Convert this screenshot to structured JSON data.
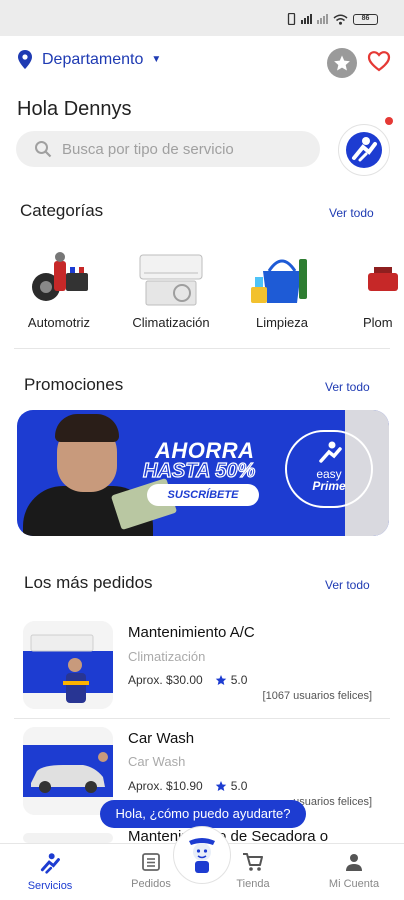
{
  "colors": {
    "brand": "#1d3cd1",
    "accent_red": "#e53935"
  },
  "status_bar": {
    "battery": "86"
  },
  "header": {
    "location": "Departamento",
    "greeting": "Hola Dennys",
    "search_placeholder": "Busca por tipo de servicio"
  },
  "categories": {
    "title": "Categorías",
    "see_all": "Ver todo",
    "items": [
      {
        "label": "Automotriz"
      },
      {
        "label": "Climatización"
      },
      {
        "label": "Limpieza"
      },
      {
        "label": "Plom"
      }
    ]
  },
  "promotions": {
    "title": "Promociones",
    "see_all": "Ver todo",
    "banner": {
      "headline": "AHORRA",
      "subheadline": "HASTA 50%",
      "cta": "SUSCRÍBETE",
      "badge_brand": "easy",
      "badge_tier": "Prime"
    }
  },
  "most_ordered": {
    "title": "Los más pedidos",
    "see_all": "Ver todo",
    "items": [
      {
        "title": "Mantenimiento A/C",
        "category": "Climatización",
        "price": "Aprox. $30.00",
        "rating": "5.0",
        "reviews": "[1067 usuarios felices]"
      },
      {
        "title": "Car Wash",
        "category": "Car Wash",
        "price": "Aprox. $10.90",
        "rating": "5.0",
        "reviews": "usuarios felices]"
      },
      {
        "title": "Mantenimiento de Secadora o"
      }
    ]
  },
  "chat": {
    "prompt": "Hola, ¿cómo puedo ayudarte?"
  },
  "nav": {
    "items": [
      {
        "label": "Servicios"
      },
      {
        "label": "Pedidos"
      },
      {
        "label": "Tienda"
      },
      {
        "label": "Mi Cuenta"
      }
    ]
  }
}
